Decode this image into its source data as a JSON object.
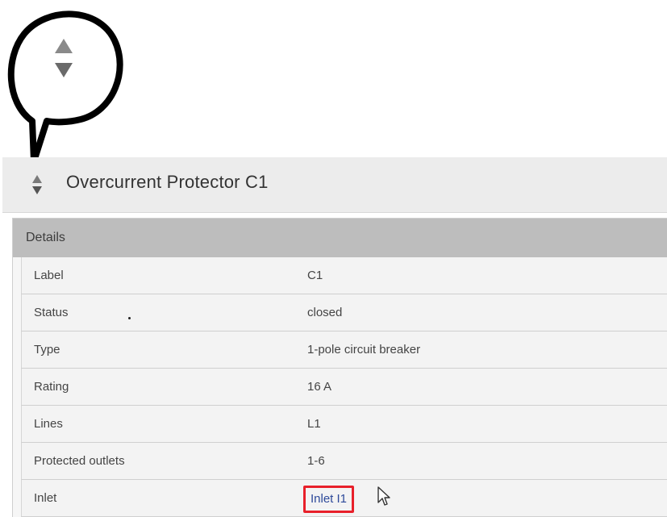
{
  "header": {
    "title": "Overcurrent Protector C1"
  },
  "details": {
    "heading": "Details",
    "rows": [
      {
        "label": "Label",
        "value": "C1"
      },
      {
        "label": "Status",
        "value": "closed"
      },
      {
        "label": "Type",
        "value": "1-pole circuit breaker"
      },
      {
        "label": "Rating",
        "value": "16 A"
      },
      {
        "label": "Lines",
        "value": "L1"
      },
      {
        "label": "Protected outlets",
        "value": "1-6"
      },
      {
        "label": "Inlet",
        "value": "Inlet I1"
      }
    ]
  },
  "icons": {
    "callout": "sort-arrows-icon",
    "header": "sort-arrows-icon",
    "pointer": "mouse-cursor-icon"
  },
  "colors": {
    "header_bg": "#ececec",
    "panel_head_bg": "#bdbdbd",
    "row_bg": "#f3f3f3",
    "link": "#2e4a9a",
    "highlight_box": "#e8202a",
    "callout_stroke": "#000000"
  }
}
